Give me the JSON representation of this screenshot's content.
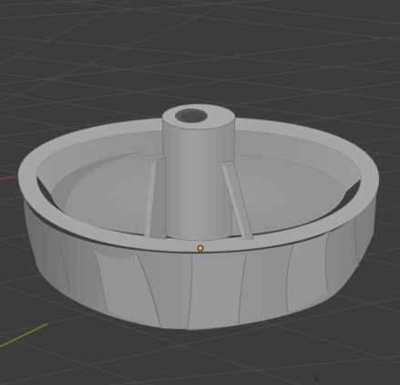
{
  "viewport": {
    "mode": "3d-viewport",
    "background_color": "#3c3c3c",
    "grid_color": "#494949",
    "x_axis_color": "#8a3a44",
    "y_axis_color": "#6a8a2c"
  },
  "scene": {
    "selected_object": "knob-mesh",
    "mesh_color": "#8c8c8c",
    "origin_marker_color": "#e8a33a",
    "shading": "solid"
  }
}
